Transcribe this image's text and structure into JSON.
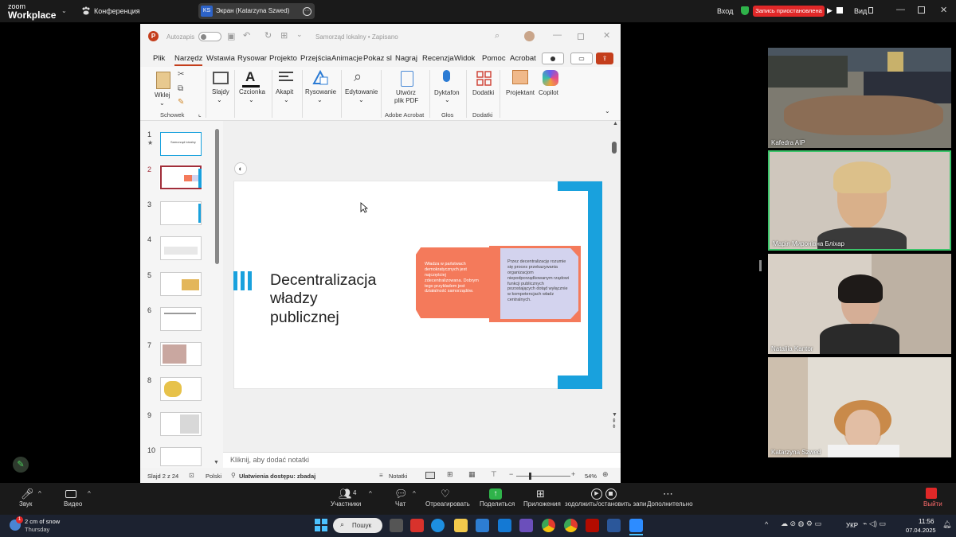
{
  "zoom": {
    "logo_line1": "zoom",
    "logo_line2": "Workplace",
    "conference_label": "Конференция",
    "screen_badge": "KS",
    "screen_label": "Экран (Katarzyna Szwed)",
    "signin": "Вход",
    "recording_status": "Запись приостановлена",
    "view_label": "Вид",
    "bottom": {
      "audio": "Звук",
      "video": "Видео",
      "participants": "Участники",
      "participants_count": "4",
      "chat": "Чат",
      "reactions": "Отреагировать",
      "share": "Поделиться",
      "apps": "Приложения",
      "record": "зодолжить/остановить запи",
      "more": "Дополнительно",
      "leave": "Выйти"
    }
  },
  "ppt": {
    "autosave": "Autozapis",
    "doc_title": "Samorząd lokalny • Zapisano",
    "menu": [
      "Plik",
      "Narzędz",
      "Wstawia",
      "Rysowar",
      "Projekto",
      "Przejścia",
      "Animacje",
      "Pokaz sl",
      "Nagraj",
      "Recenzja",
      "Widok",
      "Pomoc",
      "Acrobat"
    ],
    "active_menu": "Narzędz",
    "ribbon": {
      "paste": "Wklej",
      "clipboard_group": "Schowek",
      "slides": "Slajdy",
      "font": "Czcionka",
      "paragraph": "Akapit",
      "drawing": "Rysowanie",
      "editing": "Edytowanie",
      "create_pdf_1": "Utwórz",
      "create_pdf_2": "plik PDF",
      "acrobat_group": "Adobe Acrobat",
      "dictate": "Dyktafon",
      "voice_group": "Głos",
      "addins": "Dodatki",
      "addins_group": "Dodatki",
      "designer": "Projektant",
      "copilot": "Copilot"
    },
    "slide_numbers": [
      "1",
      "2",
      "3",
      "4",
      "5",
      "6",
      "7",
      "8",
      "9",
      "10"
    ],
    "slide1_title": "Samorząd lokalny",
    "slide": {
      "title_line1": "Decentralizacja",
      "title_line2": "władzy",
      "title_line3": "publicznej",
      "orange_text": "Władza w państwach demokratycznych jest najczęściej zdecentralizowana. Dobrym tego przykładem jest działalność samorządów.",
      "lavender_text": "Przez decentralizację rozumie się proces przekazywania organizacjom niepodporządkowanym rządowi funkcji publicznych pozostających dotąd wyłącznie w kompetencjach władz centralnych."
    },
    "notes_placeholder": "Kliknij, aby dodać notatki",
    "status": {
      "slide_of": "Slajd 2 z 24",
      "language": "Polski",
      "accessibility": "Ułatwienia dostępu: zbadaj",
      "notes": "Notatki",
      "zoom": "54%"
    }
  },
  "participants": [
    {
      "name": "Kafedra AIP"
    },
    {
      "name": "Марія Миронівна Бліхар"
    },
    {
      "name": "Nataliia Kantor"
    },
    {
      "name": "Katarzyna Szwed"
    }
  ],
  "taskbar": {
    "weather": "2 cm of snow",
    "day": "Thursday",
    "weather_badge": "1",
    "search": "Пошук",
    "lang": "УКР",
    "time": "11:56",
    "date": "07.04.2025"
  }
}
